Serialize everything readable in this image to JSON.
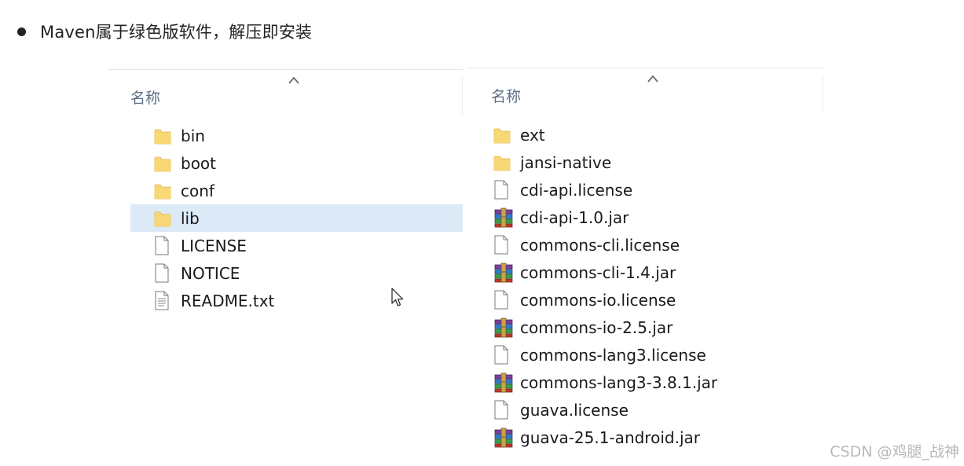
{
  "heading": {
    "text": "Maven属于绿色版软件，解压即安装"
  },
  "left_panel": {
    "column_header": "名称",
    "items": [
      {
        "name": "bin",
        "type": "folder"
      },
      {
        "name": "boot",
        "type": "folder"
      },
      {
        "name": "conf",
        "type": "folder"
      },
      {
        "name": "lib",
        "type": "folder",
        "selected": true
      },
      {
        "name": "LICENSE",
        "type": "file"
      },
      {
        "name": "NOTICE",
        "type": "file"
      },
      {
        "name": "README.txt",
        "type": "text-file"
      }
    ]
  },
  "right_panel": {
    "column_header": "名称",
    "items": [
      {
        "name": "ext",
        "type": "folder"
      },
      {
        "name": "jansi-native",
        "type": "folder"
      },
      {
        "name": "cdi-api.license",
        "type": "file"
      },
      {
        "name": "cdi-api-1.0.jar",
        "type": "archive"
      },
      {
        "name": "commons-cli.license",
        "type": "file"
      },
      {
        "name": "commons-cli-1.4.jar",
        "type": "archive"
      },
      {
        "name": "commons-io.license",
        "type": "file"
      },
      {
        "name": "commons-io-2.5.jar",
        "type": "archive"
      },
      {
        "name": "commons-lang3.license",
        "type": "file"
      },
      {
        "name": "commons-lang3-3.8.1.jar",
        "type": "archive"
      },
      {
        "name": "guava.license",
        "type": "file"
      },
      {
        "name": "guava-25.1-android.jar",
        "type": "archive"
      }
    ]
  },
  "watermark": "CSDN @鸡腿_战神",
  "colors": {
    "folder": "#f8d775",
    "selected_row": "#dce9f7",
    "header_text": "#5c6f87"
  }
}
